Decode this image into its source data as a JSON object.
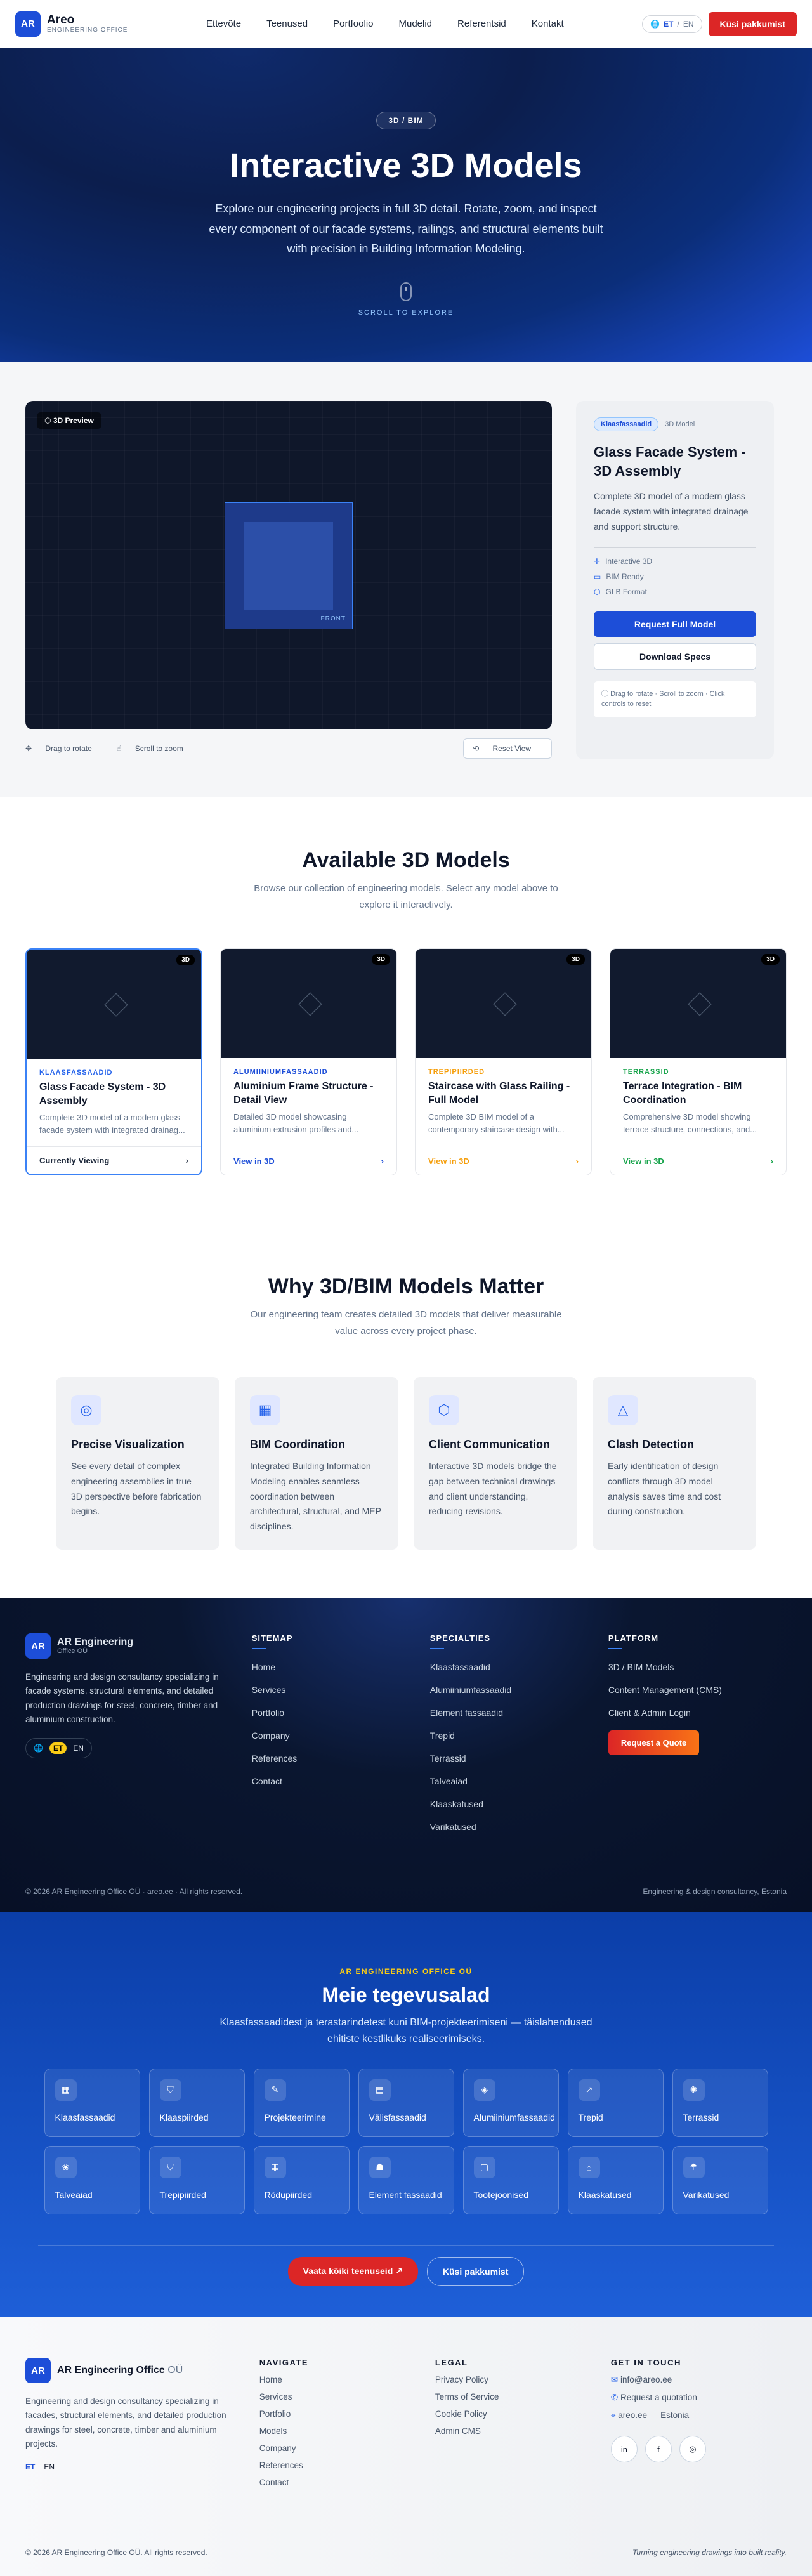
{
  "nav": {
    "logo": "AR",
    "brand": "Areo",
    "brand_sub": "ENGINEERING OFFICE",
    "menu": [
      "Ettevõte",
      "Teenused",
      "Portfoolio",
      "Mudelid",
      "Referentsid",
      "Kontakt"
    ],
    "lang_et": "ET",
    "lang_sep": "/",
    "lang_en": "EN",
    "cta": "Küsi pakkumist"
  },
  "hero": {
    "pill": "3D / BIM",
    "title": "Interactive 3D Models",
    "text": "Explore our engineering projects in full 3D detail. Rotate, zoom, and inspect every component of our facade systems, railings, and structural elements built with precision in Building Information Modeling.",
    "scroll": "SCROLL TO EXPLORE"
  },
  "viewer": {
    "tag": "3D Preview",
    "face": "FRONT",
    "drag": "Drag to rotate",
    "zoom": "Scroll to zoom",
    "reset": "Reset View",
    "chip": "Klaasfassaadid",
    "chip2": "3D Model",
    "title": "Glass Facade System - 3D Assembly",
    "desc": "Complete 3D model of a modern glass facade system with integrated drainage and support structure.",
    "features": [
      "Interactive 3D",
      "BIM Ready",
      "GLB Format"
    ],
    "btn1": "Request Full Model",
    "btn2": "Download Specs",
    "hint": "Drag to rotate · Scroll to zoom · Click controls to reset"
  },
  "models": {
    "title": "Available 3D Models",
    "sub": "Browse our collection of engineering models. Select any model above to explore it interactively.",
    "badge": "3D",
    "cards": [
      {
        "cat": "KLAASFASSAADID",
        "title": "Glass Facade System - 3D Assembly",
        "desc": "Complete 3D model of a modern glass facade system with integrated drainag...",
        "action": "Currently Viewing",
        "color": "#2563eb"
      },
      {
        "cat": "ALUMIINIUMFASSAADID",
        "title": "Aluminium Frame Structure - Detail View",
        "desc": "Detailed 3D model showcasing aluminium extrusion profiles and...",
        "action": "View in 3D",
        "color": "#1d4ed8"
      },
      {
        "cat": "TREPIPIIRDED",
        "title": "Staircase with Glass Railing - Full Model",
        "desc": "Complete 3D BIM model of a contemporary staircase design with...",
        "action": "View in 3D",
        "color": "#f59e0b"
      },
      {
        "cat": "TERRASSID",
        "title": "Terrace Integration - BIM Coordination",
        "desc": "Comprehensive 3D model showing terrace structure, connections, and...",
        "action": "View in 3D",
        "color": "#16a34a"
      }
    ]
  },
  "why": {
    "title": "Why 3D/BIM Models Matter",
    "sub": "Our engineering team creates detailed 3D models that deliver measurable value across every project phase.",
    "cards": [
      {
        "icon": "◎",
        "title": "Precise Visualization",
        "text": "See every detail of complex engineering assemblies in true 3D perspective before fabrication begins."
      },
      {
        "icon": "▦",
        "title": "BIM Coordination",
        "text": "Integrated Building Information Modeling enables seamless coordination between architectural, structural, and MEP disciplines."
      },
      {
        "icon": "⬡",
        "title": "Client Communication",
        "text": "Interactive 3D models bridge the gap between technical drawings and client understanding, reducing revisions."
      },
      {
        "icon": "△",
        "title": "Clash Detection",
        "text": "Early identification of design conflicts through 3D model analysis saves time and cost during construction."
      }
    ]
  },
  "footer1": {
    "logo": "AR",
    "brand": "AR Engineering",
    "brand_sub": "Office OÜ",
    "desc": "Engineering and design consultancy specializing in facade systems, structural elements, and detailed production drawings for steel, concrete, timber and aluminium construction.",
    "lang_et": "ET",
    "lang_en": "EN",
    "sitemap_h": "SITEMAP",
    "sitemap": [
      "Home",
      "Services",
      "Portfolio",
      "Company",
      "References",
      "Contact"
    ],
    "spec_h": "SPECIALTIES",
    "spec": [
      "Klaasfassaadid",
      "Alumiiniumfassaadid",
      "Element fassaadid",
      "Trepid",
      "Terrassid",
      "Talveaiad",
      "Klaaskatused",
      "Varikatused"
    ],
    "plat_h": "PLATFORM",
    "plat": [
      "3D / BIM Models",
      "Content Management (CMS)",
      "Client & Admin Login"
    ],
    "quote": "Request a Quote",
    "copy": "© 2026 AR Engineering Office OÜ · areo.ee · All rights reserved.",
    "tagline": "Engineering & design consultancy, Estonia"
  },
  "services": {
    "eyebrow": "AR ENGINEERING OFFICE OÜ",
    "title": "Meie tegevusalad",
    "text": "Klaasfassaadidest ja terastarindetest kuni BIM-projekteerimiseni — täislahendused ehitiste kestlikuks realiseerimiseks.",
    "items": [
      {
        "icon": "▦",
        "label": "Klaasfassaadid"
      },
      {
        "icon": "⛉",
        "label": "Klaaspiirded"
      },
      {
        "icon": "✎",
        "label": "Projekteerimine"
      },
      {
        "icon": "▤",
        "label": "Välisfassaadid"
      },
      {
        "icon": "◈",
        "label": "Alumiiniumfassaadid"
      },
      {
        "icon": "↗",
        "label": "Trepid"
      },
      {
        "icon": "✺",
        "label": "Terrassid"
      },
      {
        "icon": "❀",
        "label": "Talveaiad"
      },
      {
        "icon": "⛉",
        "label": "Trepipiirded"
      },
      {
        "icon": "▦",
        "label": "Rõdupiirded"
      },
      {
        "icon": "☗",
        "label": "Element fassaadid"
      },
      {
        "icon": "▢",
        "label": "Tootejoonised"
      },
      {
        "icon": "⌂",
        "label": "Klaaskatused"
      },
      {
        "icon": "☂",
        "label": "Varikatused"
      }
    ],
    "btn1": "Vaata kõiki teenuseid",
    "btn2": "Küsi pakkumist"
  },
  "footer2": {
    "logo": "AR",
    "brand": "AR Engineering Office",
    "brand_suffix": "OÜ",
    "desc": "Engineering and design consultancy specializing in facades, structural elements, and detailed production drawings for steel, concrete, timber and aluminium projects.",
    "lang_et": "ET",
    "lang_en": "EN",
    "nav_h": "NAVIGATE",
    "nav": [
      "Home",
      "Services",
      "Portfolio",
      "Models",
      "Company",
      "References",
      "Contact"
    ],
    "legal_h": "LEGAL",
    "legal": [
      "Privacy Policy",
      "Terms of Service",
      "Cookie Policy",
      "Admin CMS"
    ],
    "touch_h": "GET IN TOUCH",
    "touch": [
      "info@areo.ee",
      "Request a quotation",
      "areo.ee — Estonia"
    ],
    "copy": "© 2026 AR Engineering Office OÜ. All rights reserved.",
    "tagline": "Turning engineering drawings into built reality."
  }
}
